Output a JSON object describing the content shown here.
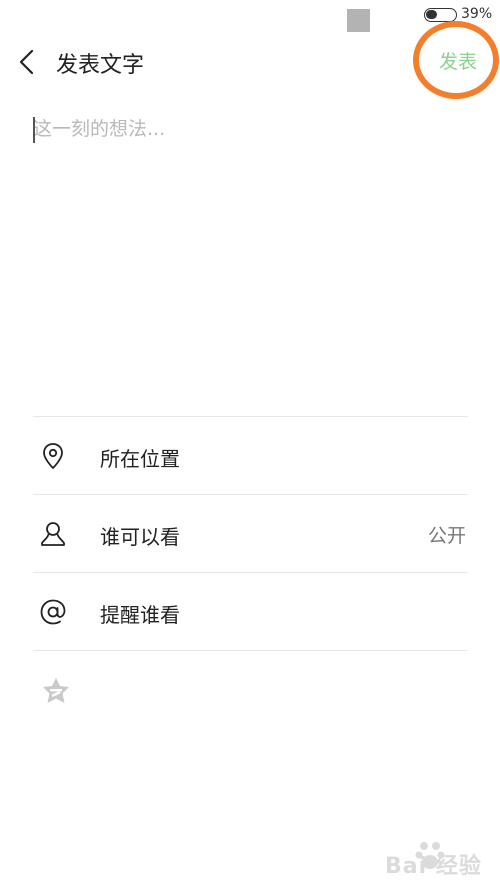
{
  "status_bar": {
    "battery_percent_text": "39%",
    "battery_level": 0.39
  },
  "header": {
    "back_icon": "chevron-left-icon",
    "title": "发表文字",
    "publish_label": "发表"
  },
  "compose": {
    "placeholder": "这一刻的想法..."
  },
  "options": [
    {
      "icon": "location-pin-icon",
      "label": "所在位置",
      "value": ""
    },
    {
      "icon": "person-icon",
      "label": "谁可以看",
      "value": "公开"
    },
    {
      "icon": "at-sign-icon",
      "label": "提醒谁看",
      "value": ""
    }
  ],
  "extra": {
    "icon": "star-badge-icon"
  },
  "colors": {
    "publish_text": "#8bd28e",
    "highlight_ring": "#f37f2c",
    "divider": "#e7e7e7",
    "placeholder": "#b9b9b9"
  },
  "watermark": {
    "text": "Bai 经验"
  }
}
